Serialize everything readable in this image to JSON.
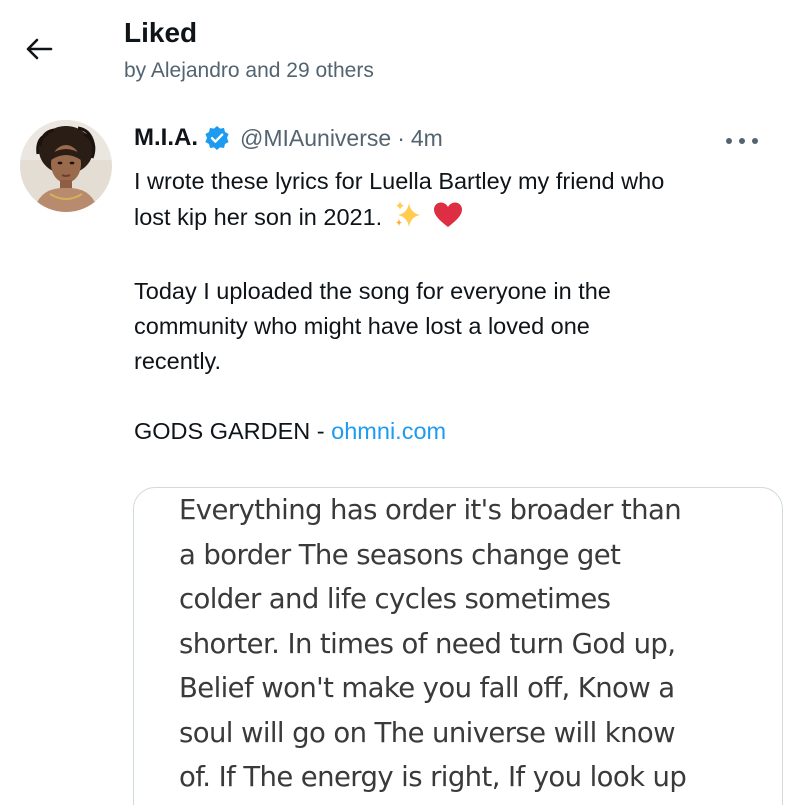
{
  "header": {
    "title": "Liked",
    "subtitle": "by Alejandro and 29 others",
    "back_icon": "arrow-left-icon"
  },
  "tweet": {
    "display_name": "M.I.A.",
    "verified_icon": "verified-badge-icon",
    "handle": "@MIAuniverse",
    "separator": "·",
    "time": "4m",
    "more_icon": "more-horizontal-icon",
    "text_lines": [
      "I wrote these lyrics  for Luella Bartley my friend  who",
      "lost kip her son in 2021."
    ],
    "emojis": [
      "sparkles-icon",
      "red-heart-icon"
    ],
    "paragraph2_lines": [
      "Today I uploaded the  song for everyone  in the",
      "community who might have lost a loved one",
      "recently."
    ],
    "song_label": "GODS GARDEN - ",
    "link_text": "ohmni.com",
    "link_color": "#1d9bf0",
    "lyrics_lines": [
      "Everything has order it's broader than",
      "a border The seasons change get",
      "colder and life cycles sometimes",
      "shorter. In times of need turn God up,",
      "Belief won't make you fall off, Know a",
      "soul will go on The universe will know",
      "of. If The energy is right, If you look up"
    ]
  }
}
